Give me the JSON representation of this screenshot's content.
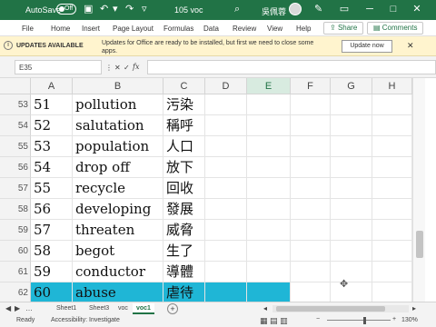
{
  "titlebar": {
    "autosave_label": "AutoSave",
    "autosave_state": "Off",
    "doc_title": "105 voc",
    "user_name": "吳佩蓉"
  },
  "ribbon": {
    "tabs": [
      "File",
      "Home",
      "Insert",
      "Page Layout",
      "Formulas",
      "Data",
      "Review",
      "View",
      "Help"
    ],
    "share_label": "Share",
    "comments_label": "Comments"
  },
  "message": {
    "title": "UPDATES AVAILABLE",
    "text": "Updates for Office are ready to be installed, but first we need to close some apps.",
    "button_label": "Update now"
  },
  "formula_bar": {
    "name_box": "E35",
    "fx": "fx",
    "content": ""
  },
  "grid": {
    "columns": [
      "A",
      "B",
      "C",
      "D",
      "E",
      "F",
      "G",
      "H"
    ],
    "selected_column": "E",
    "rows": [
      {
        "row": "53",
        "num": "51",
        "word": "pollution",
        "meaning": "污染"
      },
      {
        "row": "54",
        "num": "52",
        "word": "salutation",
        "meaning": "稱呼"
      },
      {
        "row": "55",
        "num": "53",
        "word": "population",
        "meaning": "人口"
      },
      {
        "row": "56",
        "num": "54",
        "word": "drop off",
        "meaning": "放下"
      },
      {
        "row": "57",
        "num": "55",
        "word": "recycle",
        "meaning": "回收"
      },
      {
        "row": "58",
        "num": "56",
        "word": "developing",
        "meaning": "發展"
      },
      {
        "row": "59",
        "num": "57",
        "word": "threaten",
        "meaning": "威脅"
      },
      {
        "row": "60",
        "num": "58",
        "word": "begot",
        "meaning": "生了"
      },
      {
        "row": "61",
        "num": "59",
        "word": "conductor",
        "meaning": "導體"
      },
      {
        "row": "62",
        "num": "60",
        "word": "abuse",
        "meaning": "虐待"
      }
    ],
    "highlight_color": "#1fb6d6"
  },
  "sheets": {
    "tabs": [
      "Sheet1",
      "Sheet3",
      "voc",
      "voc1"
    ],
    "active": "voc1",
    "add_label": "+"
  },
  "status": {
    "ready": "Ready",
    "accessibility": "Accessibility: Investigate",
    "zoom": "130%"
  },
  "colors": {
    "brand": "#217346",
    "message_bg": "#fff4ce"
  }
}
